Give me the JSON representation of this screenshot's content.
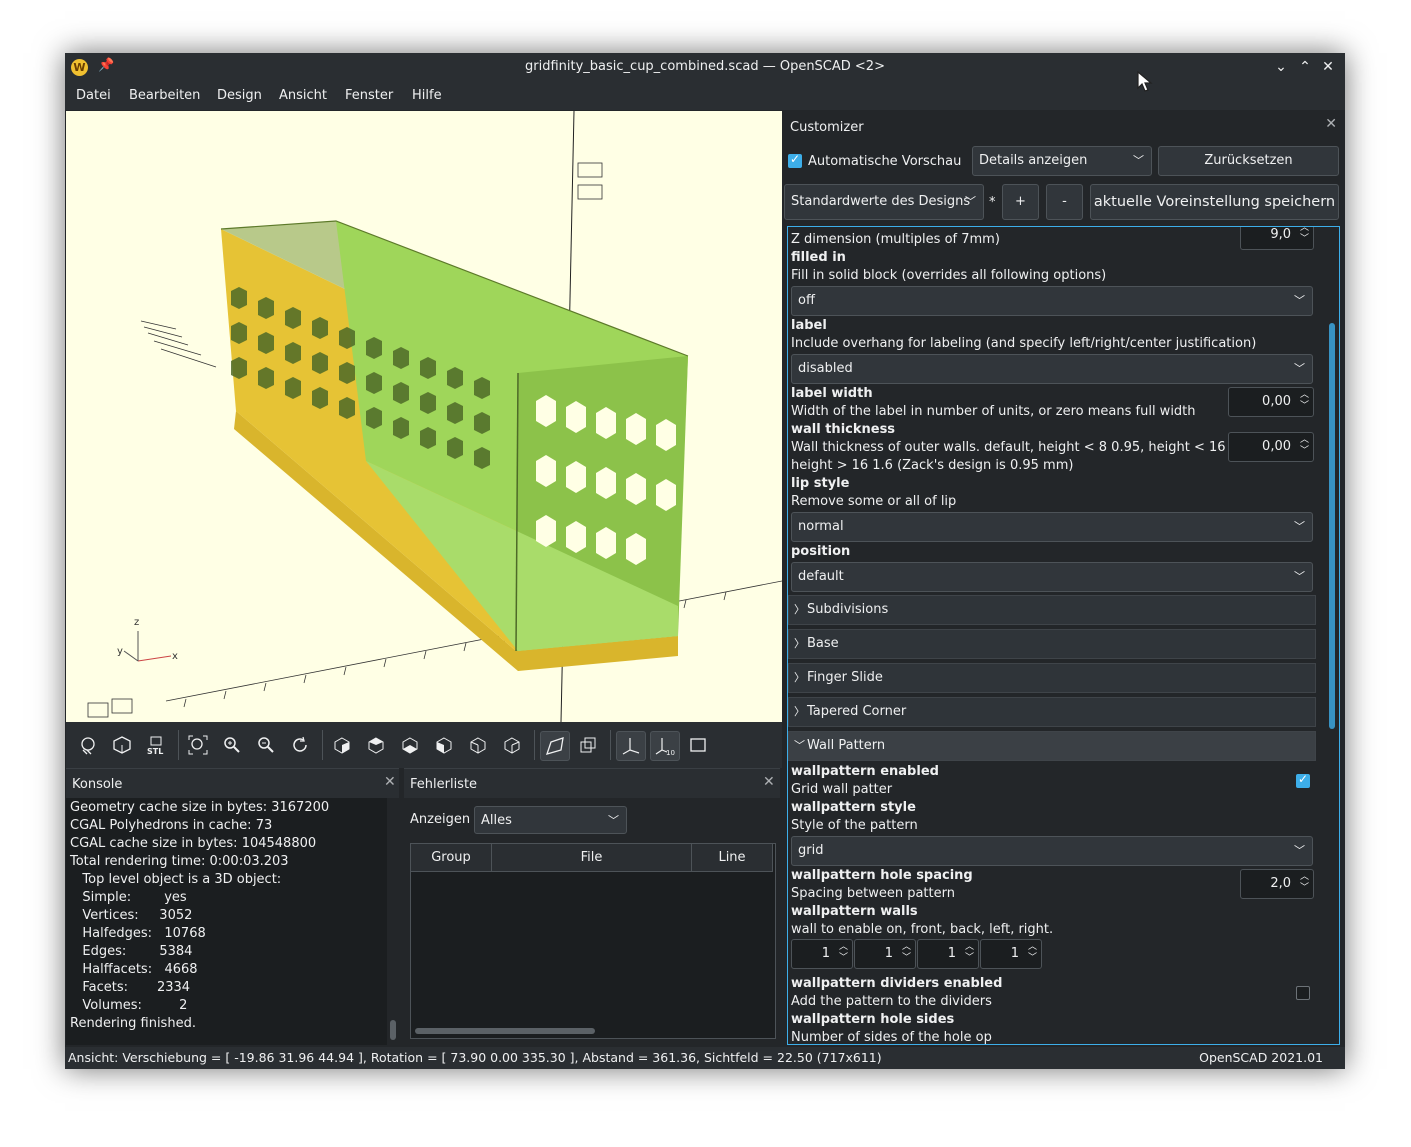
{
  "window": {
    "title": "gridfinity_basic_cup_combined.scad — OpenSCAD <2>",
    "controls": [
      "minimize-icon",
      "maximize-icon",
      "close-icon"
    ]
  },
  "menu": [
    "Datei",
    "Bearbeiten",
    "Design",
    "Ansicht",
    "Fenster",
    "Hilfe"
  ],
  "viewport": {
    "axis_labels": {
      "z": "z",
      "x": "x",
      "y": "y"
    },
    "model_colors": {
      "side": "#e6c335",
      "top": "#9fd65a",
      "background": "#ffffe5"
    }
  },
  "toolbar": [
    "render-icon",
    "preview-icon",
    "export-stl-icon",
    "view-all-icon",
    "zoom-in-icon",
    "zoom-out-icon",
    "reset-view-icon",
    "view-right-icon",
    "view-top-icon",
    "view-bottom-icon",
    "view-left-icon",
    "view-front-icon",
    "view-back-icon",
    "perspective-icon",
    "orthogonal-icon",
    "show-axes-icon",
    "show-scale-icon",
    "show-edges-icon"
  ],
  "console": {
    "title": "Konsole",
    "lines": [
      "Geometry cache size in bytes: 3167200",
      "CGAL Polyhedrons in cache: 73",
      "CGAL cache size in bytes: 104548800",
      "Total rendering time: 0:00:03.203",
      "   Top level object is a 3D object:",
      "   Simple:        yes",
      "   Vertices:     3052",
      "   Halfedges:   10768",
      "   Edges:        5384",
      "   Halffacets:   4668",
      "   Facets:       2334",
      "   Volumes:         2",
      "Rendering finished."
    ]
  },
  "errors": {
    "title": "Fehlerliste",
    "show_label": "Anzeigen",
    "show_value": "Alles",
    "columns": [
      "Group",
      "File",
      "Line"
    ]
  },
  "customizer": {
    "title": "Customizer",
    "auto_preview_label": "Automatische Vorschau",
    "auto_preview_checked": true,
    "details_value": "Details anzeigen",
    "reset_label": "Zurücksetzen",
    "preset_value": "Standardwerte des Designs",
    "preset_modified": "*",
    "add_label": "+",
    "remove_label": "-",
    "save_label": "aktuelle Voreinstellung speichern",
    "z_desc": "Z dimension (multiples of 7mm)",
    "z_value": "9,0",
    "filled_label": "filled in",
    "filled_desc": "Fill in solid block (overrides all following options)",
    "filled_value": "off",
    "label_label": "label",
    "label_desc": "Include overhang for labeling (and specify left/right/center justification)",
    "label_value": "disabled",
    "label_width_label": "label width",
    "label_width_desc": "Width of the label in number of units, or zero means full width",
    "label_width_value": "0,00",
    "wall_label": "wall thickness",
    "wall_desc1": "Wall thickness of outer walls. default, height < 8 0.95, height < 16 1.2,",
    "wall_desc2": "height > 16 1.6 (Zack's design is 0.95 mm)",
    "wall_value": "0,00",
    "lip_label": "lip style",
    "lip_desc": "Remove some or all of lip",
    "lip_value": "normal",
    "position_label": "position",
    "position_value": "default",
    "sections": [
      "Subdivisions",
      "Base",
      "Finger Slide",
      "Tapered Corner",
      "Wall Pattern"
    ],
    "wp_enabled_label": "wallpattern enabled",
    "wp_enabled_desc": "Grid wall patter",
    "wp_enabled_checked": true,
    "wp_style_label": "wallpattern style",
    "wp_style_desc": "Style of the pattern",
    "wp_style_value": "grid",
    "wp_spacing_label": "wallpattern hole spacing",
    "wp_spacing_desc": "Spacing between pattern",
    "wp_spacing_value": "2,0",
    "wp_walls_label": "wallpattern walls",
    "wp_walls_desc": "wall to enable on, front, back, left, right.",
    "wp_walls_values": [
      "1",
      "1",
      "1",
      "1"
    ],
    "wp_dividers_label": "wallpattern dividers enabled",
    "wp_dividers_desc": "Add the pattern to the dividers",
    "wp_dividers_checked": false,
    "wp_sides_label": "wallpattern hole sides",
    "wp_sides_desc": "Number of sides of the hole op"
  },
  "status": {
    "left": "Ansicht: Verschiebung = [ -19.86 31.96 44.94 ], Rotation = [ 73.90 0.00 335.30 ], Abstand = 361.36, Sichtfeld = 22.50 (717x611)",
    "right": "OpenSCAD 2021.01"
  }
}
